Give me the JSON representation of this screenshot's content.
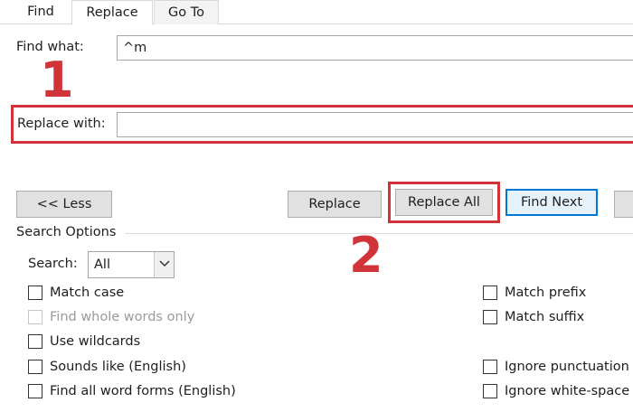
{
  "tabs": [
    {
      "label": "Find",
      "active": false
    },
    {
      "label": "Replace",
      "active": true
    },
    {
      "label": "Go To",
      "active": false
    }
  ],
  "find_what": {
    "label": "Find what:",
    "value": "^m"
  },
  "replace_with": {
    "label": "Replace with:",
    "value": ""
  },
  "annotations": {
    "step1": "1",
    "step2": "2",
    "color": "#d13438"
  },
  "buttons": {
    "less": "<< Less",
    "replace": "Replace",
    "replace_all": "Replace All",
    "find_next": "Find Next"
  },
  "search_options": {
    "title": "Search Options",
    "search_label": "Search:",
    "search_value": "All"
  },
  "options_left": [
    {
      "label": "Match case",
      "checked": false,
      "enabled": true
    },
    {
      "label": "Find whole words only",
      "checked": false,
      "enabled": false
    },
    {
      "label": "Use wildcards",
      "checked": false,
      "enabled": true
    },
    {
      "label": "Sounds like (English)",
      "checked": false,
      "enabled": true
    },
    {
      "label": "Find all word forms (English)",
      "checked": false,
      "enabled": true
    }
  ],
  "options_right": [
    {
      "label": "Match prefix",
      "checked": false,
      "enabled": true
    },
    {
      "label": "Match suffix",
      "checked": false,
      "enabled": true
    },
    {
      "label": "Ignore punctuation",
      "checked": false,
      "enabled": true
    },
    {
      "label": "Ignore white-space",
      "checked": false,
      "enabled": true
    }
  ],
  "accent_color": "#0078d7"
}
